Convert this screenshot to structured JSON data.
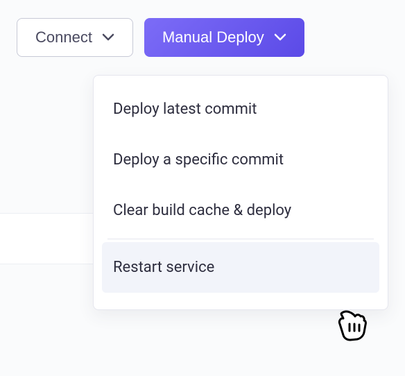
{
  "toolbar": {
    "connect_label": "Connect",
    "manual_deploy_label": "Manual Deploy"
  },
  "dropdown": {
    "items": [
      {
        "label": "Deploy latest commit"
      },
      {
        "label": "Deploy a specific commit"
      },
      {
        "label": "Clear build cache & deploy"
      }
    ],
    "restart_label": "Restart service"
  }
}
